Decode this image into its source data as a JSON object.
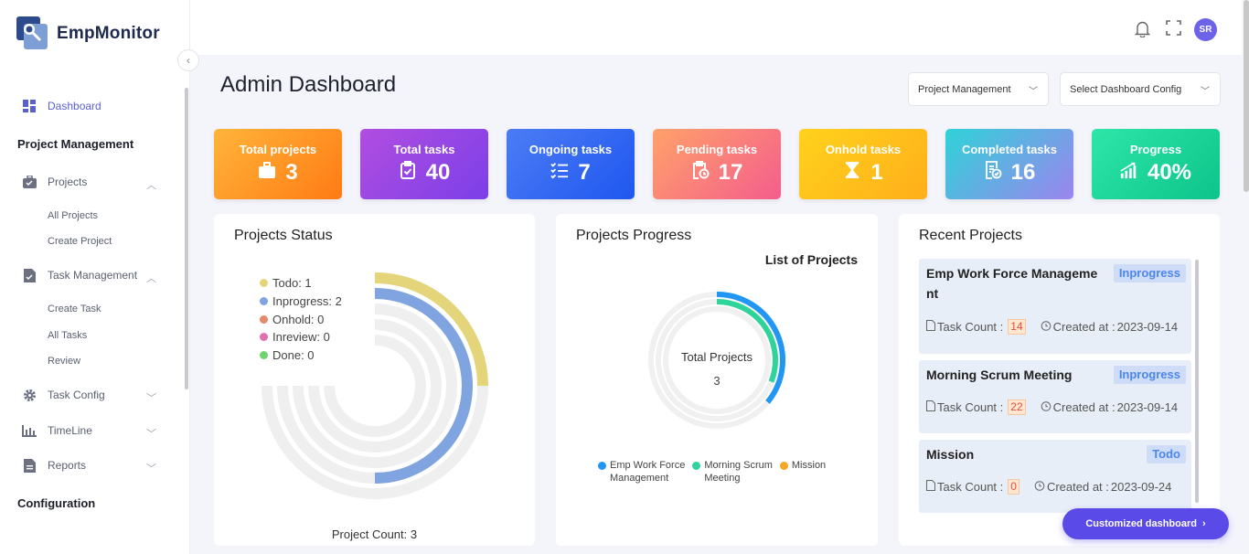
{
  "app": {
    "name": "EmpMonitor"
  },
  "sidebar": {
    "dashboard": "Dashboard",
    "section_project": "Project Management",
    "projects": "Projects",
    "all_projects": "All Projects",
    "create_project": "Create Project",
    "task_management": "Task Management",
    "create_task": "Create Task",
    "all_tasks": "All Tasks",
    "review": "Review",
    "task_config": "Task Config",
    "timeline": "TimeLine",
    "reports": "Reports",
    "section_config": "Configuration"
  },
  "header": {
    "avatar_initials": "SR"
  },
  "page": {
    "title": "Admin Dashboard",
    "select_module": "Project Management",
    "select_config": "Select Dashboard Config"
  },
  "stats": [
    {
      "label": "Total projects",
      "value": "3",
      "icon": "briefcase-icon",
      "from": "#ffb43a",
      "to": "#ff7b13"
    },
    {
      "label": "Total tasks",
      "value": "40",
      "icon": "clipboard-check-icon",
      "from": "#b14ee0",
      "to": "#7b3fe8"
    },
    {
      "label": "Ongoing tasks",
      "value": "7",
      "icon": "task-list-icon",
      "from": "#4c7cf4",
      "to": "#1f57f0"
    },
    {
      "label": "Pending tasks",
      "value": "17",
      "icon": "clipboard-clock-icon",
      "from": "#ffa26a",
      "to": "#f45d8c"
    },
    {
      "label": "Onhold tasks",
      "value": "1",
      "icon": "hourglass-icon",
      "from": "#ffd21c",
      "to": "#ffae1a"
    },
    {
      "label": "Completed tasks",
      "value": "16",
      "icon": "document-check-icon",
      "from": "#2ed3d8",
      "to": "#9c84ee"
    },
    {
      "label": "Progress",
      "value": "40%",
      "icon": "growth-chart-icon",
      "from": "#2de6a8",
      "to": "#0dc48a"
    }
  ],
  "projects_status": {
    "title": "Projects Status",
    "footer": "Project Count: 3",
    "legend": [
      {
        "label": "Todo: 1",
        "color": "#e4d47a",
        "value": 1
      },
      {
        "label": "Inprogress: 2",
        "color": "#7fa4e0",
        "value": 2
      },
      {
        "label": "Onhold: 0",
        "color": "#e28a6b",
        "value": 0
      },
      {
        "label": "Inreview: 0",
        "color": "#e26fb0",
        "value": 0
      },
      {
        "label": "Done: 0",
        "color": "#6fd46f",
        "value": 0
      }
    ]
  },
  "projects_progress": {
    "title": "Projects Progress",
    "subtitle": "List of Projects",
    "center_label": "Total Projects",
    "center_value": "3",
    "legend": [
      {
        "line1": "Emp Work Force",
        "line2": "Management",
        "color": "#2196f3"
      },
      {
        "line1": "Morning Scrum",
        "line2": "Meeting",
        "color": "#2fd49a"
      },
      {
        "line1": "Mission",
        "line2": "",
        "color": "#f5a623"
      }
    ]
  },
  "recent_projects": {
    "title": "Recent Projects",
    "task_count_label": "Task Count :",
    "created_label": "Created at :",
    "items": [
      {
        "name_l1": "Emp Work Force Manageme",
        "name_l2": "nt",
        "status": "Inprogress",
        "count": "14",
        "created": "2023-09-14"
      },
      {
        "name_l1": "Morning Scrum Meeting",
        "name_l2": "",
        "status": "Inprogress",
        "count": "22",
        "created": "2023-09-14"
      },
      {
        "name_l1": "Mission",
        "name_l2": "",
        "status": "Todo",
        "count": "0",
        "created": "2023-09-24"
      }
    ]
  },
  "cta": {
    "label": "Customized dashboard"
  }
}
